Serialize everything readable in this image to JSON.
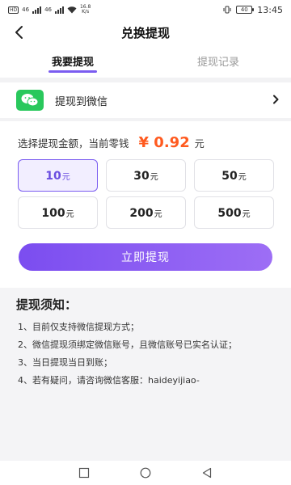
{
  "status_bar": {
    "sim1": "46",
    "sim2": "46",
    "speed_value": "16.8",
    "speed_unit": "K/s",
    "battery": "40",
    "time": "13:45"
  },
  "nav": {
    "title": "兑换提现"
  },
  "tabs": [
    {
      "label": "我要提现",
      "active": true
    },
    {
      "label": "提现记录",
      "active": false
    }
  ],
  "method": {
    "label": "提现到微信",
    "icon": "wechat-icon"
  },
  "balance": {
    "label": "选择提现金额，当前零钱",
    "value": "¥ 0.92",
    "unit": "元"
  },
  "amounts": [
    {
      "value": "10",
      "unit": "元",
      "selected": true
    },
    {
      "value": "30",
      "unit": "元",
      "selected": false
    },
    {
      "value": "50",
      "unit": "元",
      "selected": false
    },
    {
      "value": "100",
      "unit": "元",
      "selected": false
    },
    {
      "value": "200",
      "unit": "元",
      "selected": false
    },
    {
      "value": "500",
      "unit": "元",
      "selected": false
    }
  ],
  "submit_label": "立即提现",
  "notice": {
    "title": "提现须知：",
    "items": [
      "1、目前仅支持微信提现方式；",
      "2、微信提现须绑定微信账号，且微信账号已实名认证；",
      "3、当日提现当日到账；",
      "4、若有疑问，请咨询微信客服：haideyijiao-"
    ]
  },
  "colors": {
    "accent": "#7a5cf0",
    "price": "#ff5a1f",
    "wechat": "#29c85c"
  }
}
